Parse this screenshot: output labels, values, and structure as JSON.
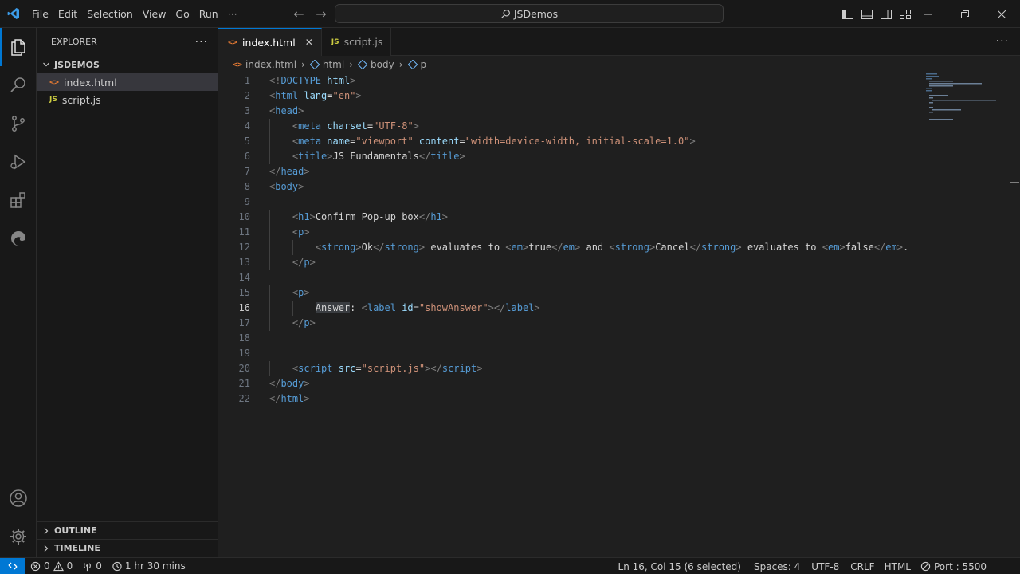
{
  "titlebar": {
    "menu": [
      "File",
      "Edit",
      "Selection",
      "View",
      "Go",
      "Run",
      "···"
    ],
    "search": "JSDemos"
  },
  "sidebar": {
    "title": "EXPLORER",
    "more": "···",
    "folder": "JSDEMOS",
    "files": [
      {
        "name": "index.html",
        "icon": "html-file-icon",
        "icon_glyph": "<>",
        "icon_color": "#e37933",
        "selected": true
      },
      {
        "name": "script.js",
        "icon": "js-file-icon",
        "icon_glyph": "JS",
        "icon_color": "#cbcb41",
        "selected": false
      }
    ],
    "outline": "OUTLINE",
    "timeline": "TIMELINE"
  },
  "tabs": [
    {
      "label": "index.html",
      "active": true
    },
    {
      "label": "script.js",
      "active": false
    }
  ],
  "breadcrumb": [
    "index.html",
    "html",
    "body",
    "p"
  ],
  "editor": {
    "current_line": 16,
    "lines": [
      [
        [
          "br",
          "<!"
        ],
        [
          "tag",
          "DOCTYPE"
        ],
        [
          "txt",
          " "
        ],
        [
          "attr",
          "html"
        ],
        [
          "br",
          ">"
        ]
      ],
      [
        [
          "br",
          "<"
        ],
        [
          "tag",
          "html"
        ],
        [
          "txt",
          " "
        ],
        [
          "attr",
          "lang"
        ],
        [
          "txt",
          "="
        ],
        [
          "str",
          "\"en\""
        ],
        [
          "br",
          ">"
        ]
      ],
      [
        [
          "br",
          "<"
        ],
        [
          "tag",
          "head"
        ],
        [
          "br",
          ">"
        ]
      ],
      [
        [
          "txt",
          "    "
        ],
        [
          "br",
          "<"
        ],
        [
          "tag",
          "meta"
        ],
        [
          "txt",
          " "
        ],
        [
          "attr",
          "charset"
        ],
        [
          "txt",
          "="
        ],
        [
          "str",
          "\"UTF-8\""
        ],
        [
          "br",
          ">"
        ]
      ],
      [
        [
          "txt",
          "    "
        ],
        [
          "br",
          "<"
        ],
        [
          "tag",
          "meta"
        ],
        [
          "txt",
          " "
        ],
        [
          "attr",
          "name"
        ],
        [
          "txt",
          "="
        ],
        [
          "str",
          "\"viewport\""
        ],
        [
          "txt",
          " "
        ],
        [
          "attr",
          "content"
        ],
        [
          "txt",
          "="
        ],
        [
          "str",
          "\"width=device-width, initial-scale=1.0\""
        ],
        [
          "br",
          ">"
        ]
      ],
      [
        [
          "txt",
          "    "
        ],
        [
          "br",
          "<"
        ],
        [
          "tag",
          "title"
        ],
        [
          "br",
          ">"
        ],
        [
          "txt",
          "JS Fundamentals"
        ],
        [
          "br",
          "</"
        ],
        [
          "tag",
          "title"
        ],
        [
          "br",
          ">"
        ]
      ],
      [
        [
          "br",
          "</"
        ],
        [
          "tag",
          "head"
        ],
        [
          "br",
          ">"
        ]
      ],
      [
        [
          "br",
          "<"
        ],
        [
          "tag",
          "body"
        ],
        [
          "br",
          ">"
        ]
      ],
      [],
      [
        [
          "txt",
          "    "
        ],
        [
          "br",
          "<"
        ],
        [
          "tag",
          "h1"
        ],
        [
          "br",
          ">"
        ],
        [
          "txt",
          "Confirm Pop-up box"
        ],
        [
          "br",
          "</"
        ],
        [
          "tag",
          "h1"
        ],
        [
          "br",
          ">"
        ]
      ],
      [
        [
          "txt",
          "    "
        ],
        [
          "br",
          "<"
        ],
        [
          "tag",
          "p"
        ],
        [
          "br",
          ">"
        ]
      ],
      [
        [
          "txt",
          "        "
        ],
        [
          "br",
          "<"
        ],
        [
          "tag",
          "strong"
        ],
        [
          "br",
          ">"
        ],
        [
          "txt",
          "Ok"
        ],
        [
          "br",
          "</"
        ],
        [
          "tag",
          "strong"
        ],
        [
          "br",
          ">"
        ],
        [
          "txt",
          " evaluates to "
        ],
        [
          "br",
          "<"
        ],
        [
          "tag",
          "em"
        ],
        [
          "br",
          ">"
        ],
        [
          "txt",
          "true"
        ],
        [
          "br",
          "</"
        ],
        [
          "tag",
          "em"
        ],
        [
          "br",
          ">"
        ],
        [
          "txt",
          " and "
        ],
        [
          "br",
          "<"
        ],
        [
          "tag",
          "strong"
        ],
        [
          "br",
          ">"
        ],
        [
          "txt",
          "Cancel"
        ],
        [
          "br",
          "</"
        ],
        [
          "tag",
          "strong"
        ],
        [
          "br",
          ">"
        ],
        [
          "txt",
          " evaluates to "
        ],
        [
          "br",
          "<"
        ],
        [
          "tag",
          "em"
        ],
        [
          "br",
          ">"
        ],
        [
          "txt",
          "false"
        ],
        [
          "br",
          "</"
        ],
        [
          "tag",
          "em"
        ],
        [
          "br",
          ">"
        ],
        [
          "txt",
          "."
        ]
      ],
      [
        [
          "txt",
          "    "
        ],
        [
          "br",
          "</"
        ],
        [
          "tag",
          "p"
        ],
        [
          "br",
          ">"
        ]
      ],
      [],
      [
        [
          "txt",
          "    "
        ],
        [
          "br",
          "<"
        ],
        [
          "tag",
          "p"
        ],
        [
          "br",
          ">"
        ]
      ],
      [
        [
          "txt",
          "        "
        ],
        [
          "sel",
          "Answer"
        ],
        [
          "txt",
          ": "
        ],
        [
          "br",
          "<"
        ],
        [
          "tag",
          "label"
        ],
        [
          "txt",
          " "
        ],
        [
          "attr",
          "id"
        ],
        [
          "txt",
          "="
        ],
        [
          "str",
          "\"showAnswer\""
        ],
        [
          "br",
          "></"
        ],
        [
          "tag",
          "label"
        ],
        [
          "br",
          ">"
        ]
      ],
      [
        [
          "txt",
          "    "
        ],
        [
          "br",
          "</"
        ],
        [
          "tag",
          "p"
        ],
        [
          "br",
          ">"
        ]
      ],
      [],
      [],
      [
        [
          "txt",
          "    "
        ],
        [
          "br",
          "<"
        ],
        [
          "tag",
          "script"
        ],
        [
          "txt",
          " "
        ],
        [
          "attr",
          "src"
        ],
        [
          "txt",
          "="
        ],
        [
          "str",
          "\"script.js\""
        ],
        [
          "br",
          "></"
        ],
        [
          "tag",
          "script"
        ],
        [
          "br",
          ">"
        ]
      ],
      [
        [
          "br",
          "</"
        ],
        [
          "tag",
          "body"
        ],
        [
          "br",
          ">"
        ]
      ],
      [
        [
          "br",
          "</"
        ],
        [
          "tag",
          "html"
        ],
        [
          "br",
          ">"
        ]
      ]
    ]
  },
  "status": {
    "errors": "0",
    "warnings": "0",
    "ports_forwarded": "0",
    "timer": "1 hr 30 mins",
    "position": "Ln 16, Col 15 (6 selected)",
    "spaces": "Spaces: 4",
    "encoding": "UTF-8",
    "eol": "CRLF",
    "language": "HTML",
    "port": "Port : 5500"
  },
  "colors": {
    "accent": "#0078d4",
    "tag": "#569cd6",
    "attr": "#9cdcfe",
    "string": "#ce9178",
    "bracket": "#808080"
  }
}
